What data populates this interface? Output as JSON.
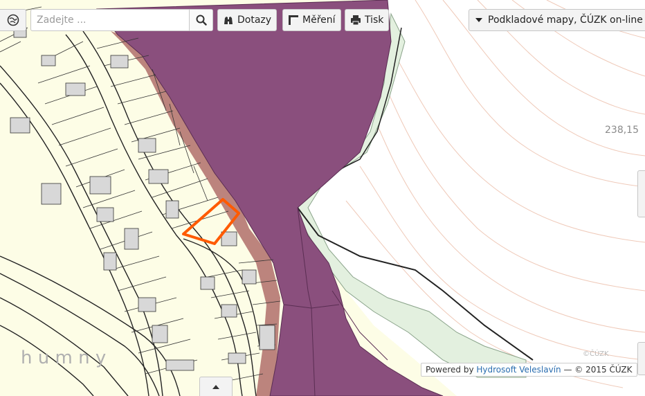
{
  "toolbar": {
    "search_placeholder": "Zadejte ...",
    "queries_label": "Dotazy",
    "measure_label": "Měření",
    "print_label": "Tisk"
  },
  "layers": {
    "selected_label": "Podkladové mapy, ČÚZK on-line"
  },
  "map": {
    "elevation_label": "238,15",
    "place_label": "h u m n y",
    "watermark": "©ČÚZK"
  },
  "attribution": {
    "powered_by": "Powered by",
    "vendor": "Hydrosoft Veleslavín",
    "suffix": "— © 2015 ČÚZK"
  },
  "colors": {
    "parcel_fill": "#fdfde6",
    "zone_purple": "#8a4f7d",
    "zone_red": "#b06e6a",
    "forest_green": "#e3f0df",
    "highlight_orange": "#ff5a00"
  },
  "icons": {
    "logo": "app-logo-icon",
    "search": "search-icon",
    "queries": "binoculars-icon",
    "measure": "ruler-icon",
    "print": "printer-icon",
    "layers": "caret-down-icon",
    "expand": "caret-up-icon"
  }
}
